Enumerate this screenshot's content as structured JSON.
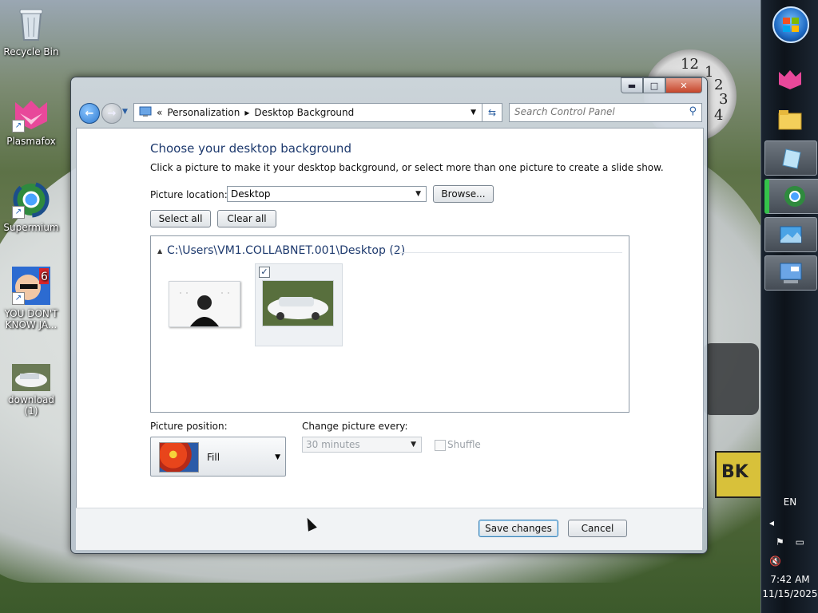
{
  "desktop": {
    "icons": [
      {
        "label": "Recycle Bin",
        "icon": "recycle-bin-icon"
      },
      {
        "label": "Plasmafox",
        "icon": "plasmafox-icon"
      },
      {
        "label": "Supermium",
        "icon": "supermium-icon"
      },
      {
        "label": "YOU DON'T KNOW JA...",
        "icon": "game-icon"
      },
      {
        "label": "download (1)",
        "icon": "car-image-icon"
      }
    ],
    "plate_text": "BK"
  },
  "clock": {
    "numbers": [
      "12",
      "1",
      "2",
      "3",
      "4"
    ]
  },
  "taskbar": {
    "language": "EN",
    "time": "7:42 AM",
    "date": "11/15/2025",
    "tray_arrow": "◂"
  },
  "window": {
    "controls": {
      "minimize": "▬",
      "maximize": "□",
      "close": "✕"
    },
    "address": {
      "root_arrow": "«",
      "seg1": "Personalization",
      "sep": "▸",
      "seg2": "Desktop Background"
    },
    "search_placeholder": "Search Control Panel",
    "heading": "Choose your desktop background",
    "subheading": "Click a picture to make it your desktop background, or select more than one picture to create a slide show.",
    "picture_location_label": "Picture location:",
    "picture_location_value": "Desktop",
    "browse_label": "Browse...",
    "select_all_label": "Select all",
    "clear_all_label": "Clear all",
    "group_title": "C:\\Users\\VM1.COLLABNET.001\\Desktop (2)",
    "thumb2_checked": "✓",
    "picture_position_label": "Picture position:",
    "picture_position_value": "Fill",
    "change_every_label": "Change picture every:",
    "change_every_value": "30 minutes",
    "shuffle_label": "Shuffle",
    "save_label": "Save changes",
    "cancel_label": "Cancel"
  },
  "colors": {
    "accent": "#1e3a6e",
    "window_chrome": "#c9d3dc"
  }
}
